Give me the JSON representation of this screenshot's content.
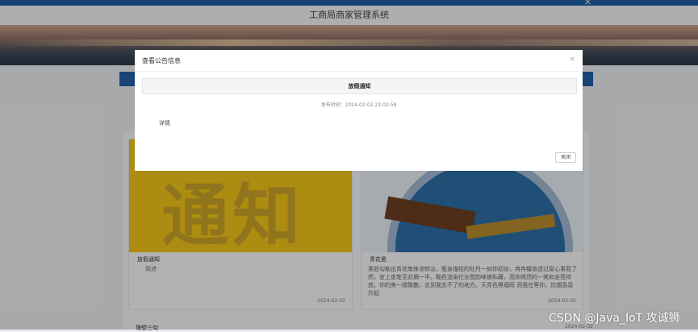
{
  "app": {
    "title": "工商局商家管理系统",
    "top_close": "✕"
  },
  "cards": [
    {
      "image_text": "通知",
      "title": "放假通知",
      "desc": "简述",
      "date": "2024-02-02"
    },
    {
      "title": "青花瓷",
      "desc": "素胚勾勒出青花笔锋浓转淡，瓶身描绘的牡丹一如你初妆，冉冉檀香透过窗心事我了然，宣上走笔至此搁一半。釉色渲染仕女图韵味被私藏，而你嫣然的一笑如含苞待放，你的美一缕飘散，去到我去不了的地方。天青色等烟雨 而我在等你，炊烟袅袅升起",
      "date": "2024-02-02"
    }
  ],
  "next_item": {
    "title": "理想三旬",
    "date": "2024-02-02"
  },
  "modal": {
    "title": "查看公告信息",
    "notice_title": "放假通知",
    "publish_time": "发布时间：2024-02-02 22:02:58",
    "detail": "详情",
    "close_label": "关闭",
    "x_icon": "×"
  },
  "watermark": "CSDN @Java_IoT 攻诚狮",
  "colors": {
    "primary": "#1f5fa6",
    "notice_yellow": "#f0c21a"
  }
}
